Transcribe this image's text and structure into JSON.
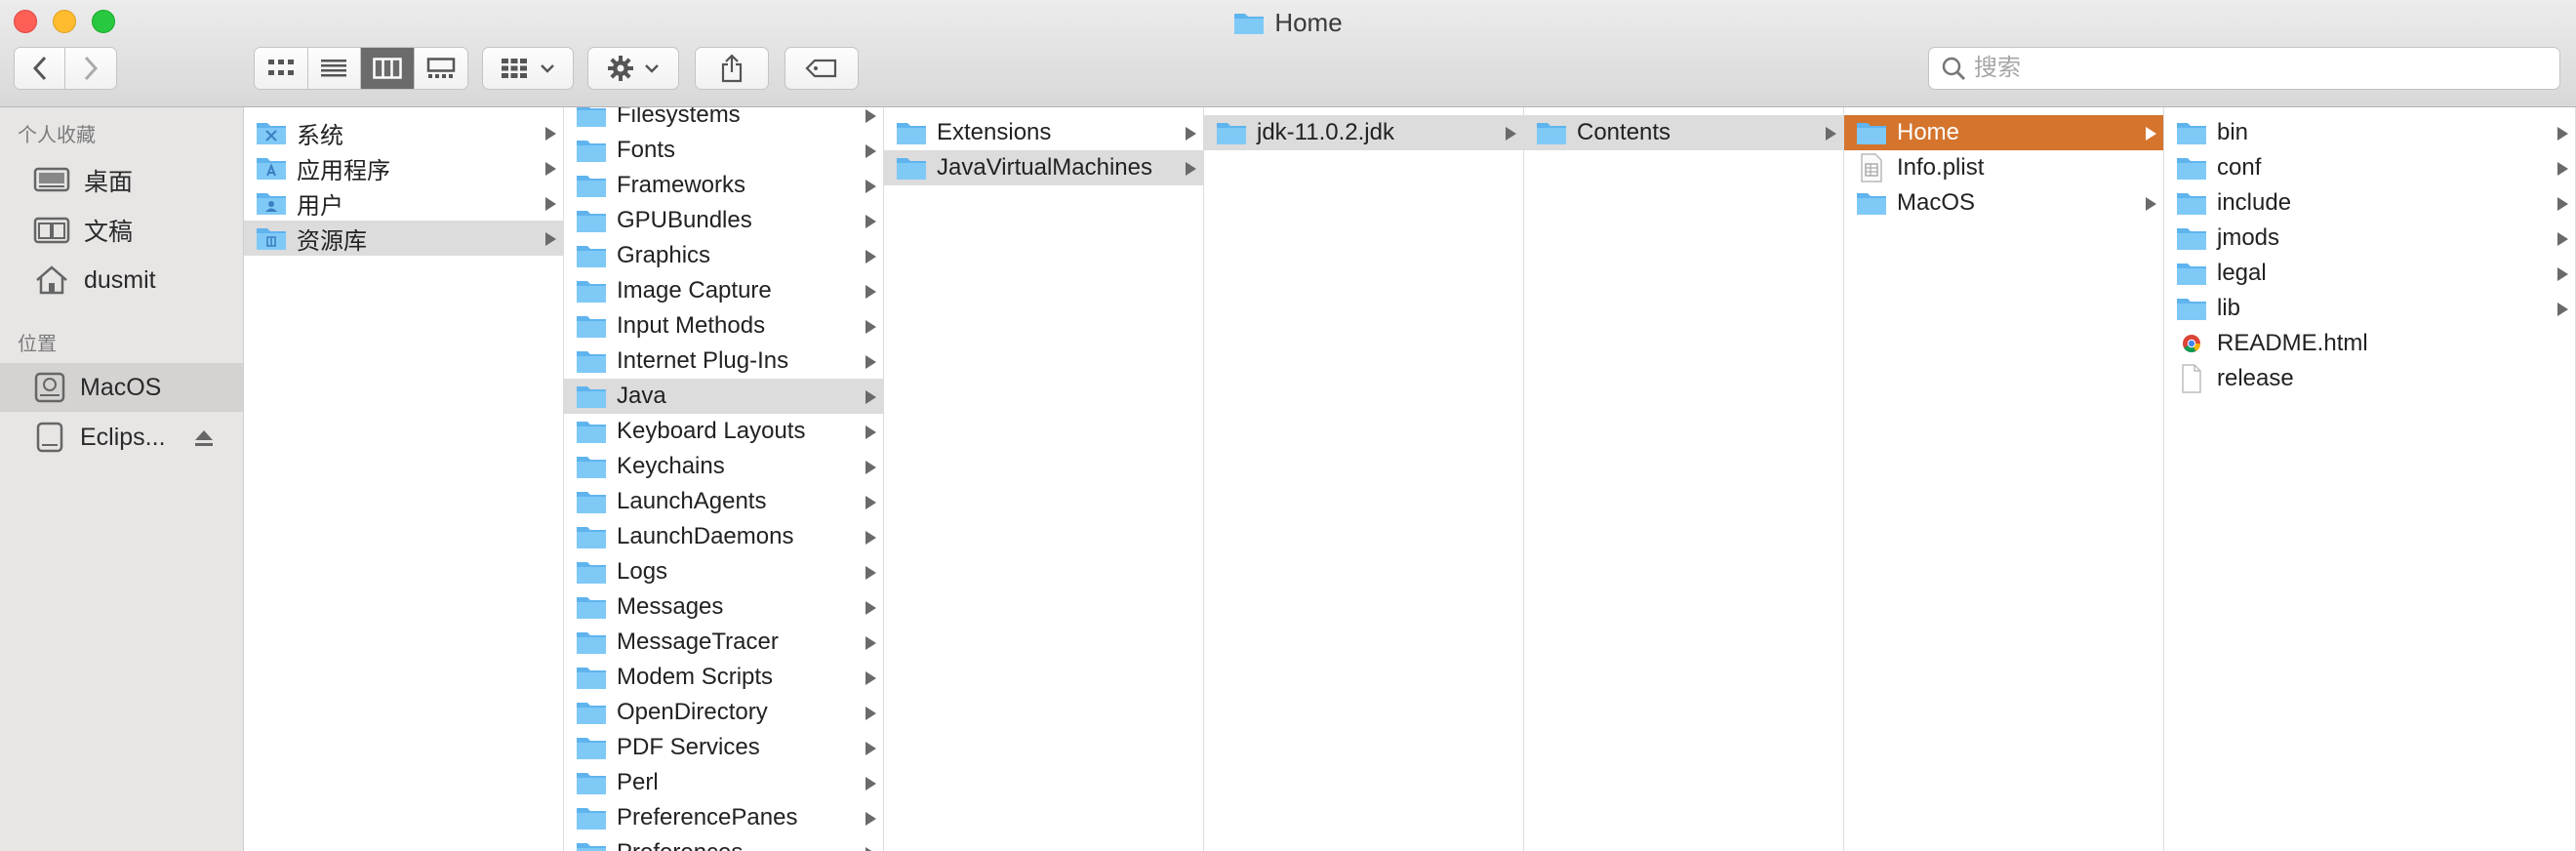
{
  "window": {
    "title": "Home"
  },
  "search": {
    "placeholder": "搜索"
  },
  "sidebar": {
    "favorites_header": "个人收藏",
    "favorites": [
      {
        "label": "桌面",
        "icon": "desktop-icon"
      },
      {
        "label": "文稿",
        "icon": "documents-icon"
      },
      {
        "label": "dusmit",
        "icon": "home-icon"
      }
    ],
    "locations_header": "位置",
    "locations": [
      {
        "label": "MacOS",
        "icon": "disk-icon",
        "selected": true
      },
      {
        "label": "Eclips...",
        "icon": "disk-icon",
        "eject": true
      }
    ]
  },
  "columns": [
    {
      "items": [
        {
          "label": "系统",
          "arrow": true,
          "icon": "system-folder-icon"
        },
        {
          "label": "应用程序",
          "arrow": true,
          "icon": "applications-folder-icon"
        },
        {
          "label": "用户",
          "arrow": true,
          "icon": "users-folder-icon"
        },
        {
          "label": "资源库",
          "arrow": true,
          "icon": "library-folder-icon",
          "state": "hl"
        }
      ]
    },
    {
      "items": [
        {
          "label": "Filesystems",
          "arrow": true
        },
        {
          "label": "Fonts",
          "arrow": true
        },
        {
          "label": "Frameworks",
          "arrow": true
        },
        {
          "label": "GPUBundles",
          "arrow": true
        },
        {
          "label": "Graphics",
          "arrow": true
        },
        {
          "label": "Image Capture",
          "arrow": true
        },
        {
          "label": "Input Methods",
          "arrow": true
        },
        {
          "label": "Internet Plug-Ins",
          "arrow": true
        },
        {
          "label": "Java",
          "arrow": true,
          "state": "hl"
        },
        {
          "label": "Keyboard Layouts",
          "arrow": true
        },
        {
          "label": "Keychains",
          "arrow": true
        },
        {
          "label": "LaunchAgents",
          "arrow": true
        },
        {
          "label": "LaunchDaemons",
          "arrow": true
        },
        {
          "label": "Logs",
          "arrow": true
        },
        {
          "label": "Messages",
          "arrow": true
        },
        {
          "label": "MessageTracer",
          "arrow": true
        },
        {
          "label": "Modem Scripts",
          "arrow": true
        },
        {
          "label": "OpenDirectory",
          "arrow": true
        },
        {
          "label": "PDF Services",
          "arrow": true
        },
        {
          "label": "Perl",
          "arrow": true
        },
        {
          "label": "PreferencePanes",
          "arrow": true
        },
        {
          "label": "Preferences",
          "arrow": true
        }
      ]
    },
    {
      "items": [
        {
          "label": "Extensions",
          "arrow": true
        },
        {
          "label": "JavaVirtualMachines",
          "arrow": true,
          "state": "hl"
        }
      ]
    },
    {
      "items": [
        {
          "label": "jdk-11.0.2.jdk",
          "arrow": true,
          "state": "hl"
        }
      ]
    },
    {
      "items": [
        {
          "label": "Contents",
          "arrow": true,
          "state": "hl"
        }
      ]
    },
    {
      "items": [
        {
          "label": "Home",
          "arrow": true,
          "state": "sel"
        },
        {
          "label": "Info.plist",
          "arrow": false,
          "icon": "plist-file-icon"
        },
        {
          "label": "MacOS",
          "arrow": true
        }
      ]
    },
    {
      "items": [
        {
          "label": "bin",
          "arrow": true
        },
        {
          "label": "conf",
          "arrow": true
        },
        {
          "label": "include",
          "arrow": true
        },
        {
          "label": "jmods",
          "arrow": true
        },
        {
          "label": "legal",
          "arrow": true
        },
        {
          "label": "lib",
          "arrow": true
        },
        {
          "label": "README.html",
          "arrow": false,
          "icon": "chrome-html-icon"
        },
        {
          "label": "release",
          "arrow": false,
          "icon": "document-icon"
        }
      ]
    }
  ],
  "colors": {
    "selection": "#d4742d",
    "folder": "#6cbff3",
    "highlight": "#dcdcdc"
  }
}
